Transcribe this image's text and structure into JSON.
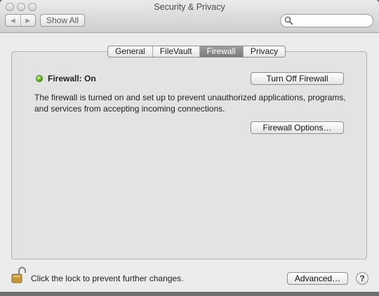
{
  "window": {
    "title": "Security & Privacy"
  },
  "toolbar": {
    "back_icon": "◀",
    "forward_icon": "▶",
    "show_all_label": "Show All"
  },
  "search": {
    "value": "",
    "placeholder": ""
  },
  "tabs": [
    {
      "label": "General",
      "active": false
    },
    {
      "label": "FileVault",
      "active": false
    },
    {
      "label": "Firewall",
      "active": true
    },
    {
      "label": "Privacy",
      "active": false
    }
  ],
  "firewall": {
    "status_label": "Firewall: On",
    "status_color": "#5cb11f",
    "toggle_button_label": "Turn Off Firewall",
    "description": "The firewall is turned on and set up to prevent unauthorized applications, programs, and services from accepting incoming connections.",
    "options_button_label": "Firewall Options…"
  },
  "footer": {
    "lock_text": "Click the lock to prevent further changes.",
    "advanced_label": "Advanced…",
    "help_label": "?"
  },
  "colors": {
    "window_bg": "#ececec",
    "active_tab": "#8a8a8a"
  }
}
